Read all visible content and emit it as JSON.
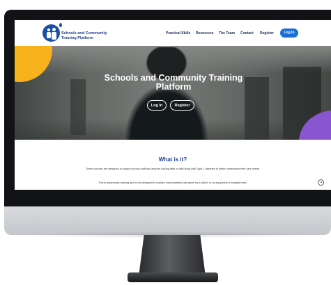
{
  "brand": {
    "name_line1": "Schools and Community",
    "name_line2": "Training Platform"
  },
  "nav": {
    "items": [
      "Practical Skills",
      "Resources",
      "The Team",
      "Contact",
      "Register"
    ],
    "login_label": "Log In"
  },
  "hero": {
    "title": "Schools and Community Training Platform",
    "login_button": "Log In",
    "register_button": "Register"
  },
  "info": {
    "heading": "What is it?",
    "paragraph1": "These courses are designed to support school staff and anyone looking after a child living with Type 1 diabetes to better understand their care needs.",
    "paragraph2": "This is awareness training and is not designed to replace individualised care given by a child's or young person's hospital team."
  },
  "colors": {
    "brand_blue": "#1a3f8f",
    "button_blue": "#1a6fd6",
    "accent_yellow": "#f7b21b",
    "accent_purple": "#8a56cf"
  },
  "icons": [
    "logo-mark-icon",
    "cookie-settings-icon"
  ]
}
